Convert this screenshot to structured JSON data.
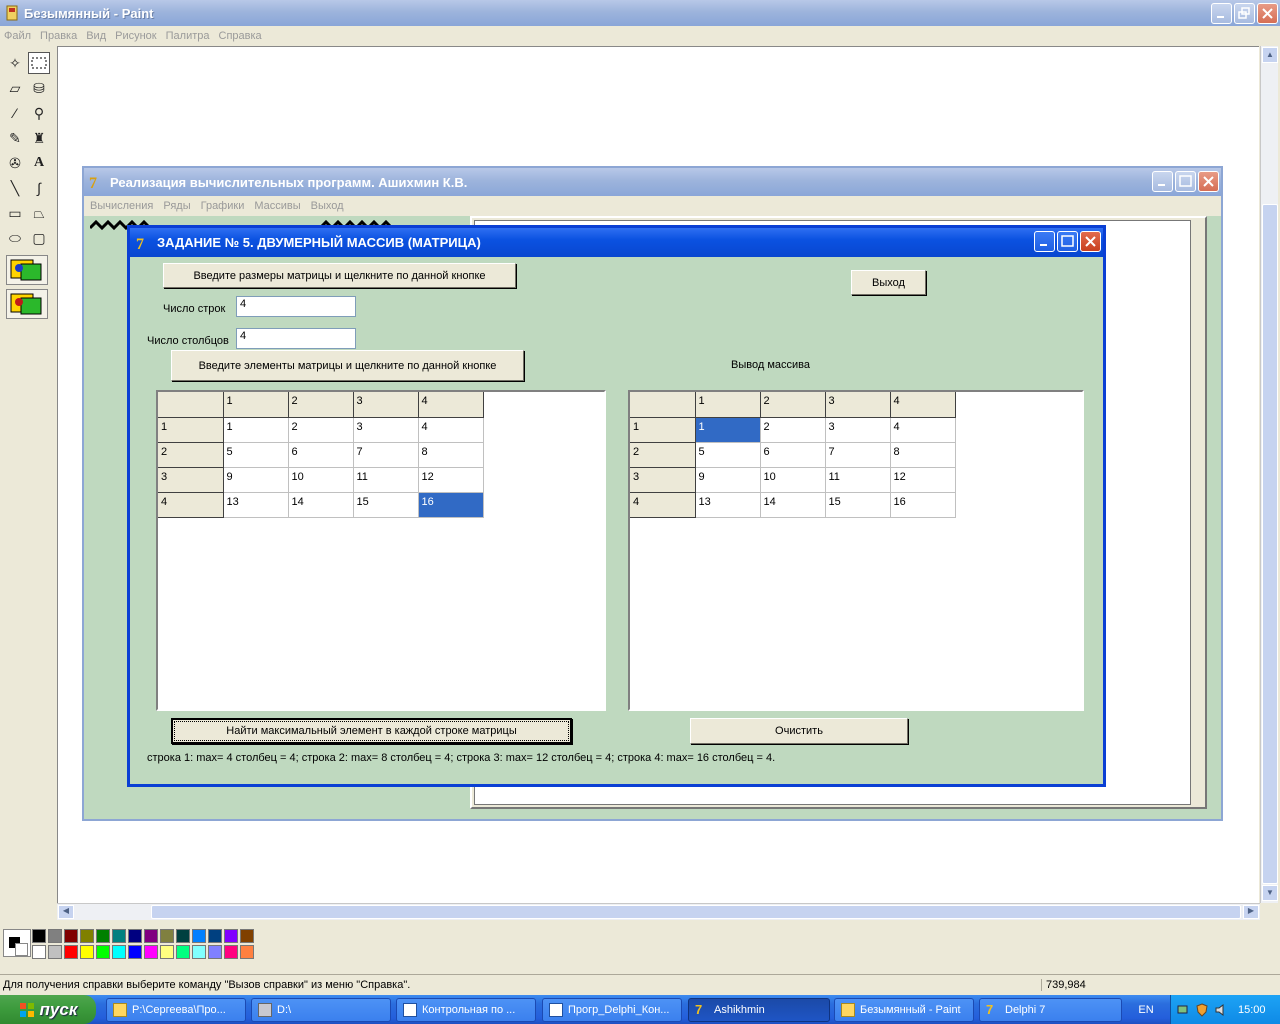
{
  "paint": {
    "title": "Безымянный - Paint",
    "menu": [
      "Файл",
      "Правка",
      "Вид",
      "Рисунок",
      "Палитра",
      "Справка"
    ],
    "status_text": "Для получения справки выберите команду \"Вызов справки\" из меню \"Справка\".",
    "coords": "739,984",
    "palette_colors": [
      "#000000",
      "#808080",
      "#800000",
      "#808000",
      "#008000",
      "#008080",
      "#000080",
      "#800080",
      "#808040",
      "#004040",
      "#0080ff",
      "#004080",
      "#8000ff",
      "#804000",
      "#ffffff",
      "#c0c0c0",
      "#ff0000",
      "#ffff00",
      "#00ff00",
      "#00ffff",
      "#0000ff",
      "#ff00ff",
      "#ffff80",
      "#00ff80",
      "#80ffff",
      "#8080ff",
      "#ff0080",
      "#ff8040"
    ]
  },
  "main_app": {
    "title": "Реализация вычислительных программ. Ашихмин К.В.",
    "menu": [
      "Вычисления",
      "Ряды",
      "Графики",
      "Массивы",
      "Выход"
    ]
  },
  "dialog": {
    "title": "ЗАДАНИЕ № 5. ДВУМЕРНЫЙ МАССИВ (МАТРИЦА)",
    "btn_size": "Введите размеры матрицы и щелкните по данной кнопке",
    "btn_exit": "Выход",
    "rows_label": "Число строк",
    "rows_value": "4",
    "cols_label": "Число столбцов",
    "cols_value": "4",
    "btn_elements": "Введите элементы матрицы и щелкните по данной кнопке",
    "output_label": "Вывод массива",
    "btn_find_max": "Найти максимальный элемент в каждой строке матрицы",
    "btn_clear": "Очистить",
    "result_text": "строка 1: max= 4 столбец = 4; строка 2: max= 8 столбец = 4; строка 3: max= 12 столбец = 4; строка 4: max= 16 столбец = 4.",
    "input_grid": {
      "col_headers": [
        "",
        "1",
        "2",
        "3",
        "4"
      ],
      "rows": [
        [
          "1",
          "1",
          "2",
          "3",
          "4"
        ],
        [
          "2",
          "5",
          "6",
          "7",
          "8"
        ],
        [
          "3",
          "9",
          "10",
          "11",
          "12"
        ],
        [
          "4",
          "13",
          "14",
          "15",
          "16"
        ]
      ]
    },
    "output_grid": {
      "col_headers": [
        "",
        "1",
        "2",
        "3",
        "4"
      ],
      "rows": [
        [
          "1",
          "1",
          "2",
          "3",
          "4"
        ],
        [
          "2",
          "5",
          "6",
          "7",
          "8"
        ],
        [
          "3",
          "9",
          "10",
          "11",
          "12"
        ],
        [
          "4",
          "13",
          "14",
          "15",
          "16"
        ]
      ]
    }
  },
  "taskbar": {
    "start_label": "пуск",
    "items": [
      "P:\\Сергеева\\Про...",
      "D:\\",
      "Контрольная по ...",
      "Прогр_Delphi_Кон...",
      "Ashikhmin",
      "Безымянный - Paint",
      "Delphi 7"
    ],
    "lang": "EN",
    "clock": "15:00"
  }
}
